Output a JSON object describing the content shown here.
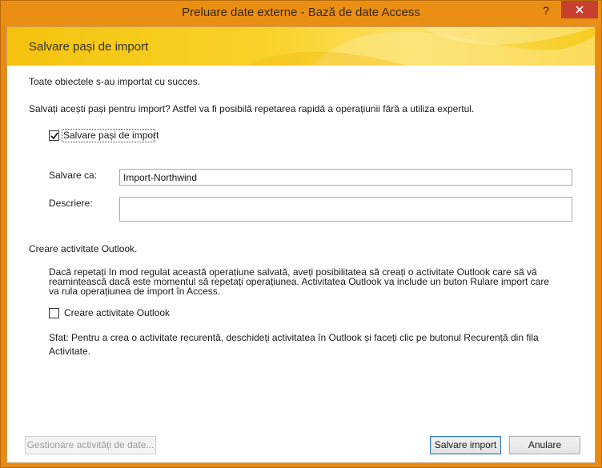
{
  "window": {
    "title": "Preluare date externe - Bază de date Access",
    "help_label": "?",
    "accent_color": "#eb8e14",
    "close_color": "#c7402f"
  },
  "banner": {
    "title": "Salvare pași de import"
  },
  "content": {
    "success_message": "Toate obiectele s-au importat cu succes.",
    "save_question": "Salvați acești pași pentru import? Astfel va fi posibilă repetarea rapidă a operațiunii fără a utiliza expertul.",
    "save_steps_checkbox": {
      "label": "Salvare pași de import",
      "checked": true
    },
    "save_as": {
      "label": "Salvare ca:",
      "value": "Import-Northwind"
    },
    "description": {
      "label": "Descriere:",
      "value": ""
    },
    "outlook_heading": "Creare activitate Outlook.",
    "outlook_info_1": "Dacă repetați în mod regulat această operațiune salvată, aveți posibilitatea să creați o activitate Outlook care să vă",
    "outlook_info_2": "reamintească dacă este momentul să repetați operațiunea. Activitatea Outlook va include un buton Rulare import care",
    "outlook_info_3": "va rula operațiunea de import în Access.",
    "outlook_checkbox": {
      "label": "Creare activitate Outlook",
      "checked": false
    },
    "tip_1": "Sfat: Pentru a crea o activitate recurentă, deschideți activitatea în Outlook și faceți clic pe butonul Recurență din fila",
    "tip_2": "Activitate."
  },
  "footer": {
    "manage_label": "Gestionare activități de date...",
    "save_import_label": "Salvare import",
    "cancel_label": "Anulare"
  }
}
